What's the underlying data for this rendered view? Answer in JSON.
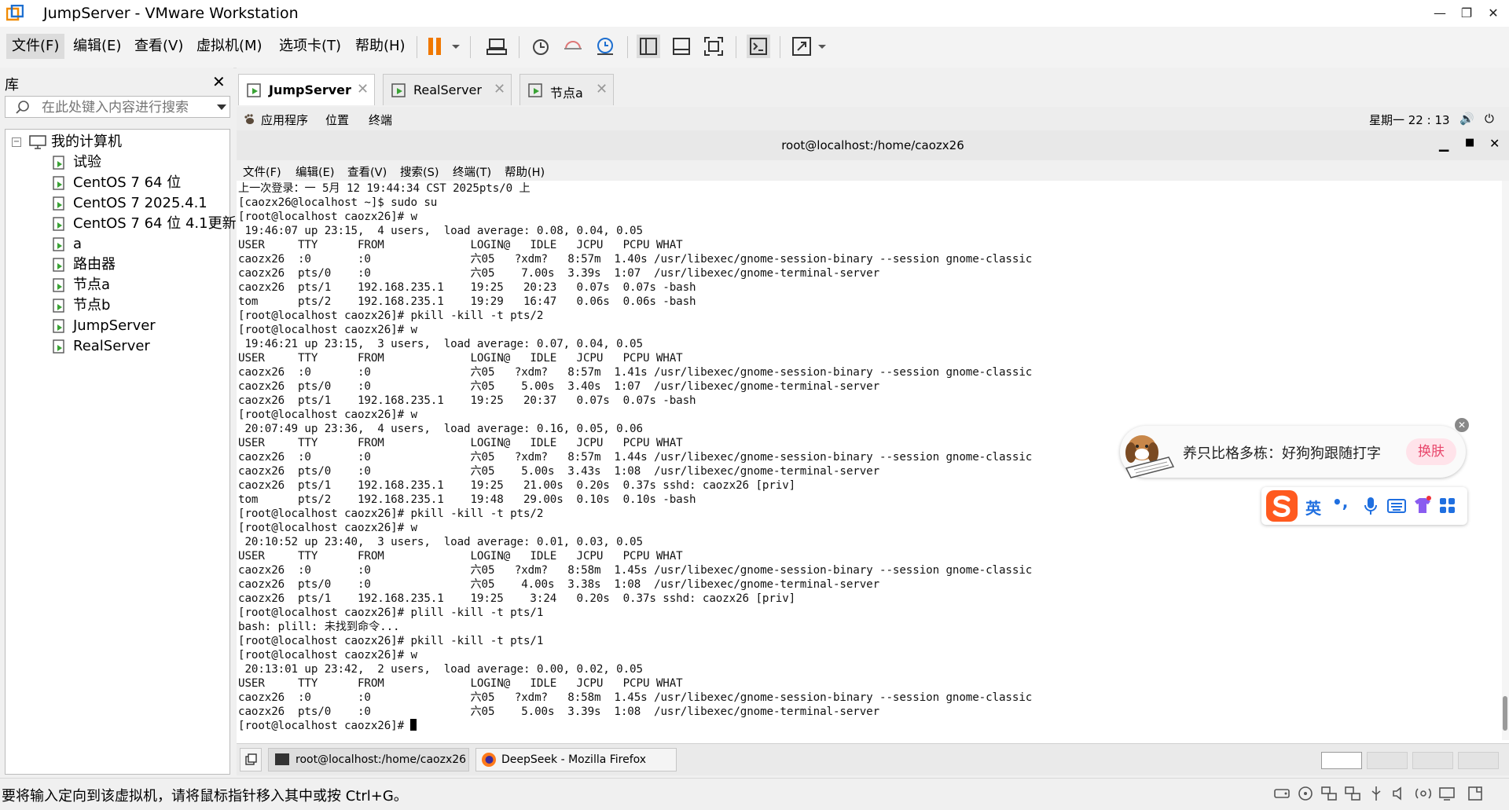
{
  "window": {
    "title": "JumpServer - VMware Workstation",
    "min": "—",
    "max": "❐",
    "close": "✕"
  },
  "menu": [
    "文件(F)",
    "编辑(E)",
    "查看(V)",
    "虚拟机(M)",
    "选项卡(T)",
    "帮助(H)"
  ],
  "library": {
    "title": "库",
    "close": "✕",
    "search_placeholder": "在此处键入内容进行搜索",
    "root": "我的计算机",
    "items": [
      "试验",
      "CentOS 7 64 位",
      "CentOS 7 2025.4.1",
      "CentOS 7 64 位 4.1更新",
      "a",
      "路由器",
      "节点a",
      "节点b",
      "JumpServer",
      "RealServer"
    ]
  },
  "tabs": [
    {
      "label": "JumpServer",
      "active": true
    },
    {
      "label": "RealServer",
      "active": false
    },
    {
      "label": "节点a",
      "active": false
    }
  ],
  "gnome": {
    "applications": "应用程序",
    "places": "位置",
    "terminal": "终端",
    "clock": "星期一 22 : 13"
  },
  "terminal": {
    "title": "root@localhost:/home/caozx26",
    "menu": [
      "文件(F)",
      "编辑(E)",
      "查看(V)",
      "搜索(S)",
      "终端(T)",
      "帮助(H)"
    ],
    "lines": [
      "上一次登录：一 5月 12 19:44:34 CST 2025pts/0 上",
      "[caozx26@localhost ~]$ sudo su",
      "[root@localhost caozx26]# w",
      " 19:46:07 up 23:15,  4 users,  load average: 0.08, 0.04, 0.05",
      "USER     TTY      FROM             LOGIN@   IDLE   JCPU   PCPU WHAT",
      "caozx26  :0       :0               六05   ?xdm?   8:57m  1.40s /usr/libexec/gnome-session-binary --session gnome-classic",
      "caozx26  pts/0    :0               六05    7.00s  3.39s  1:07  /usr/libexec/gnome-terminal-server",
      "caozx26  pts/1    192.168.235.1    19:25   20:23   0.07s  0.07s -bash",
      "tom      pts/2    192.168.235.1    19:29   16:47   0.06s  0.06s -bash",
      "[root@localhost caozx26]# pkill -kill -t pts/2",
      "[root@localhost caozx26]# w",
      " 19:46:21 up 23:15,  3 users,  load average: 0.07, 0.04, 0.05",
      "USER     TTY      FROM             LOGIN@   IDLE   JCPU   PCPU WHAT",
      "caozx26  :0       :0               六05   ?xdm?   8:57m  1.41s /usr/libexec/gnome-session-binary --session gnome-classic",
      "caozx26  pts/0    :0               六05    5.00s  3.40s  1:07  /usr/libexec/gnome-terminal-server",
      "caozx26  pts/1    192.168.235.1    19:25   20:37   0.07s  0.07s -bash",
      "[root@localhost caozx26]# w",
      " 20:07:49 up 23:36,  4 users,  load average: 0.16, 0.05, 0.06",
      "USER     TTY      FROM             LOGIN@   IDLE   JCPU   PCPU WHAT",
      "caozx26  :0       :0               六05   ?xdm?   8:57m  1.44s /usr/libexec/gnome-session-binary --session gnome-classic",
      "caozx26  pts/0    :0               六05    5.00s  3.43s  1:08  /usr/libexec/gnome-terminal-server",
      "caozx26  pts/1    192.168.235.1    19:25   21.00s  0.20s  0.37s sshd: caozx26 [priv]",
      "tom      pts/2    192.168.235.1    19:48   29.00s  0.10s  0.10s -bash",
      "[root@localhost caozx26]# pkill -kill -t pts/2",
      "[root@localhost caozx26]# w",
      " 20:10:52 up 23:40,  3 users,  load average: 0.01, 0.03, 0.05",
      "USER     TTY      FROM             LOGIN@   IDLE   JCPU   PCPU WHAT",
      "caozx26  :0       :0               六05   ?xdm?   8:58m  1.45s /usr/libexec/gnome-session-binary --session gnome-classic",
      "caozx26  pts/0    :0               六05    4.00s  3.38s  1:08  /usr/libexec/gnome-terminal-server",
      "caozx26  pts/1    192.168.235.1    19:25    3:24   0.20s  0.37s sshd: caozx26 [priv]",
      "[root@localhost caozx26]# plill -kill -t pts/1",
      "bash: plill: 未找到命令...",
      "[root@localhost caozx26]# pkill -kill -t pts/1",
      "[root@localhost caozx26]# w",
      " 20:13:01 up 23:42,  2 users,  load average: 0.00, 0.02, 0.05",
      "USER     TTY      FROM             LOGIN@   IDLE   JCPU   PCPU WHAT",
      "caozx26  :0       :0               六05   ?xdm?   8:58m  1.45s /usr/libexec/gnome-session-binary --session gnome-classic",
      "caozx26  pts/0    :0               六05    5.00s  3.39s  1:08  /usr/libexec/gnome-terminal-server"
    ],
    "prompt": "[root@localhost caozx26]# "
  },
  "guest_taskbar": [
    {
      "label": "root@localhost:/home/caozx26"
    },
    {
      "label": "DeepSeek - Mozilla Firefox"
    }
  ],
  "ime": {
    "promo_text": "养只比格多栋：好狗狗跟随打字",
    "skin_button": "换肤",
    "mode": "英",
    "punct": "•,"
  },
  "status": {
    "text": "要将输入定向到该虚拟机，请将鼠标指针移入其中或按 Ctrl+G。"
  },
  "colors": {
    "accent": "#1e6fd0",
    "pause": "#f07800",
    "vm_green": "#3aa335",
    "ime_orange": "#ff5a1f",
    "ime_blue": "#1f6fe0"
  }
}
